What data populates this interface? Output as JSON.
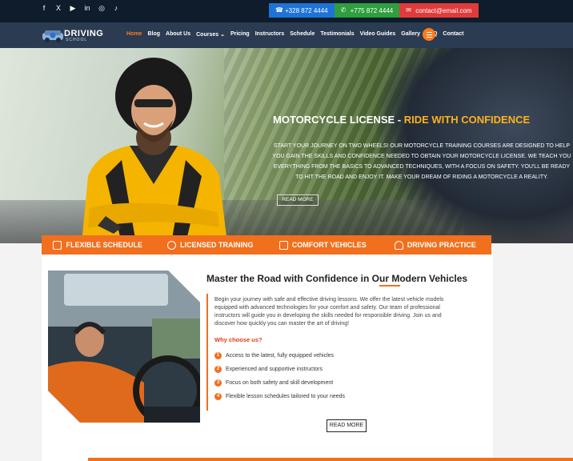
{
  "social": [
    {
      "name": "facebook-icon",
      "glyph": "f"
    },
    {
      "name": "x-icon",
      "glyph": "X"
    },
    {
      "name": "youtube-icon",
      "glyph": "▶"
    },
    {
      "name": "linkedin-icon",
      "glyph": "in"
    },
    {
      "name": "instagram-icon",
      "glyph": "◎"
    },
    {
      "name": "tiktok-icon",
      "glyph": "♪"
    }
  ],
  "contacts": {
    "phone1": "+328 872 4444",
    "phone2": "+775 872 4444",
    "email": "contact@email.com"
  },
  "logo": {
    "word": "DRIVING",
    "sub": "SCHOOL"
  },
  "menu": [
    "Home",
    "Blog",
    "About Us",
    "Courses ⌄",
    "Pricing",
    "Instructors",
    "Schedule",
    "Testimonials",
    "Video Guides",
    "Gallery",
    "FAQ",
    "Contact"
  ],
  "hero": {
    "title_main": "MOTORCYCLE LICENSE - ",
    "title_accent": "RIDE WITH CONFIDENCE",
    "text": "Start your journey on two wheels! Our motorcycle training courses are designed to help you gain the skills and confidence needed to obtain your motorcycle license. We teach you everything from the basics to advanced techniques, with a focus on safety. You'll be ready to hit the road and enjoy it. Make your dream of riding a motorcycle a reality.",
    "read_more": "READ MORE"
  },
  "features": [
    "FLEXIBLE SCHEDULE",
    "LICENSED TRAINING",
    "COMFORT VEHICLES",
    "DRIVING PRACTICE"
  ],
  "content": {
    "title": "Master the Road with Confidence in Our Modern Vehicles",
    "intro": "Begin your journey with safe and effective driving lessons. We offer the latest vehicle models equipped with advanced technologies for your comfort and safety. Our team of professional instructors will guide you in developing the skills needed for responsible driving. Join us and discover how quickly you can master the art of driving!",
    "why": "Why choose us?",
    "list": [
      "Access to the latest, fully equipped vehicles",
      "Experienced and supportive instructors",
      "Focus on both safety and skill development",
      "Flexible lesson schedules tailored to your needs"
    ],
    "read_more": "READ MORE"
  },
  "colors": {
    "accent": "#f26f1e",
    "nav": "#2a3b52",
    "topbar": "#0f1c2b",
    "highlight": "#ffb21a"
  }
}
